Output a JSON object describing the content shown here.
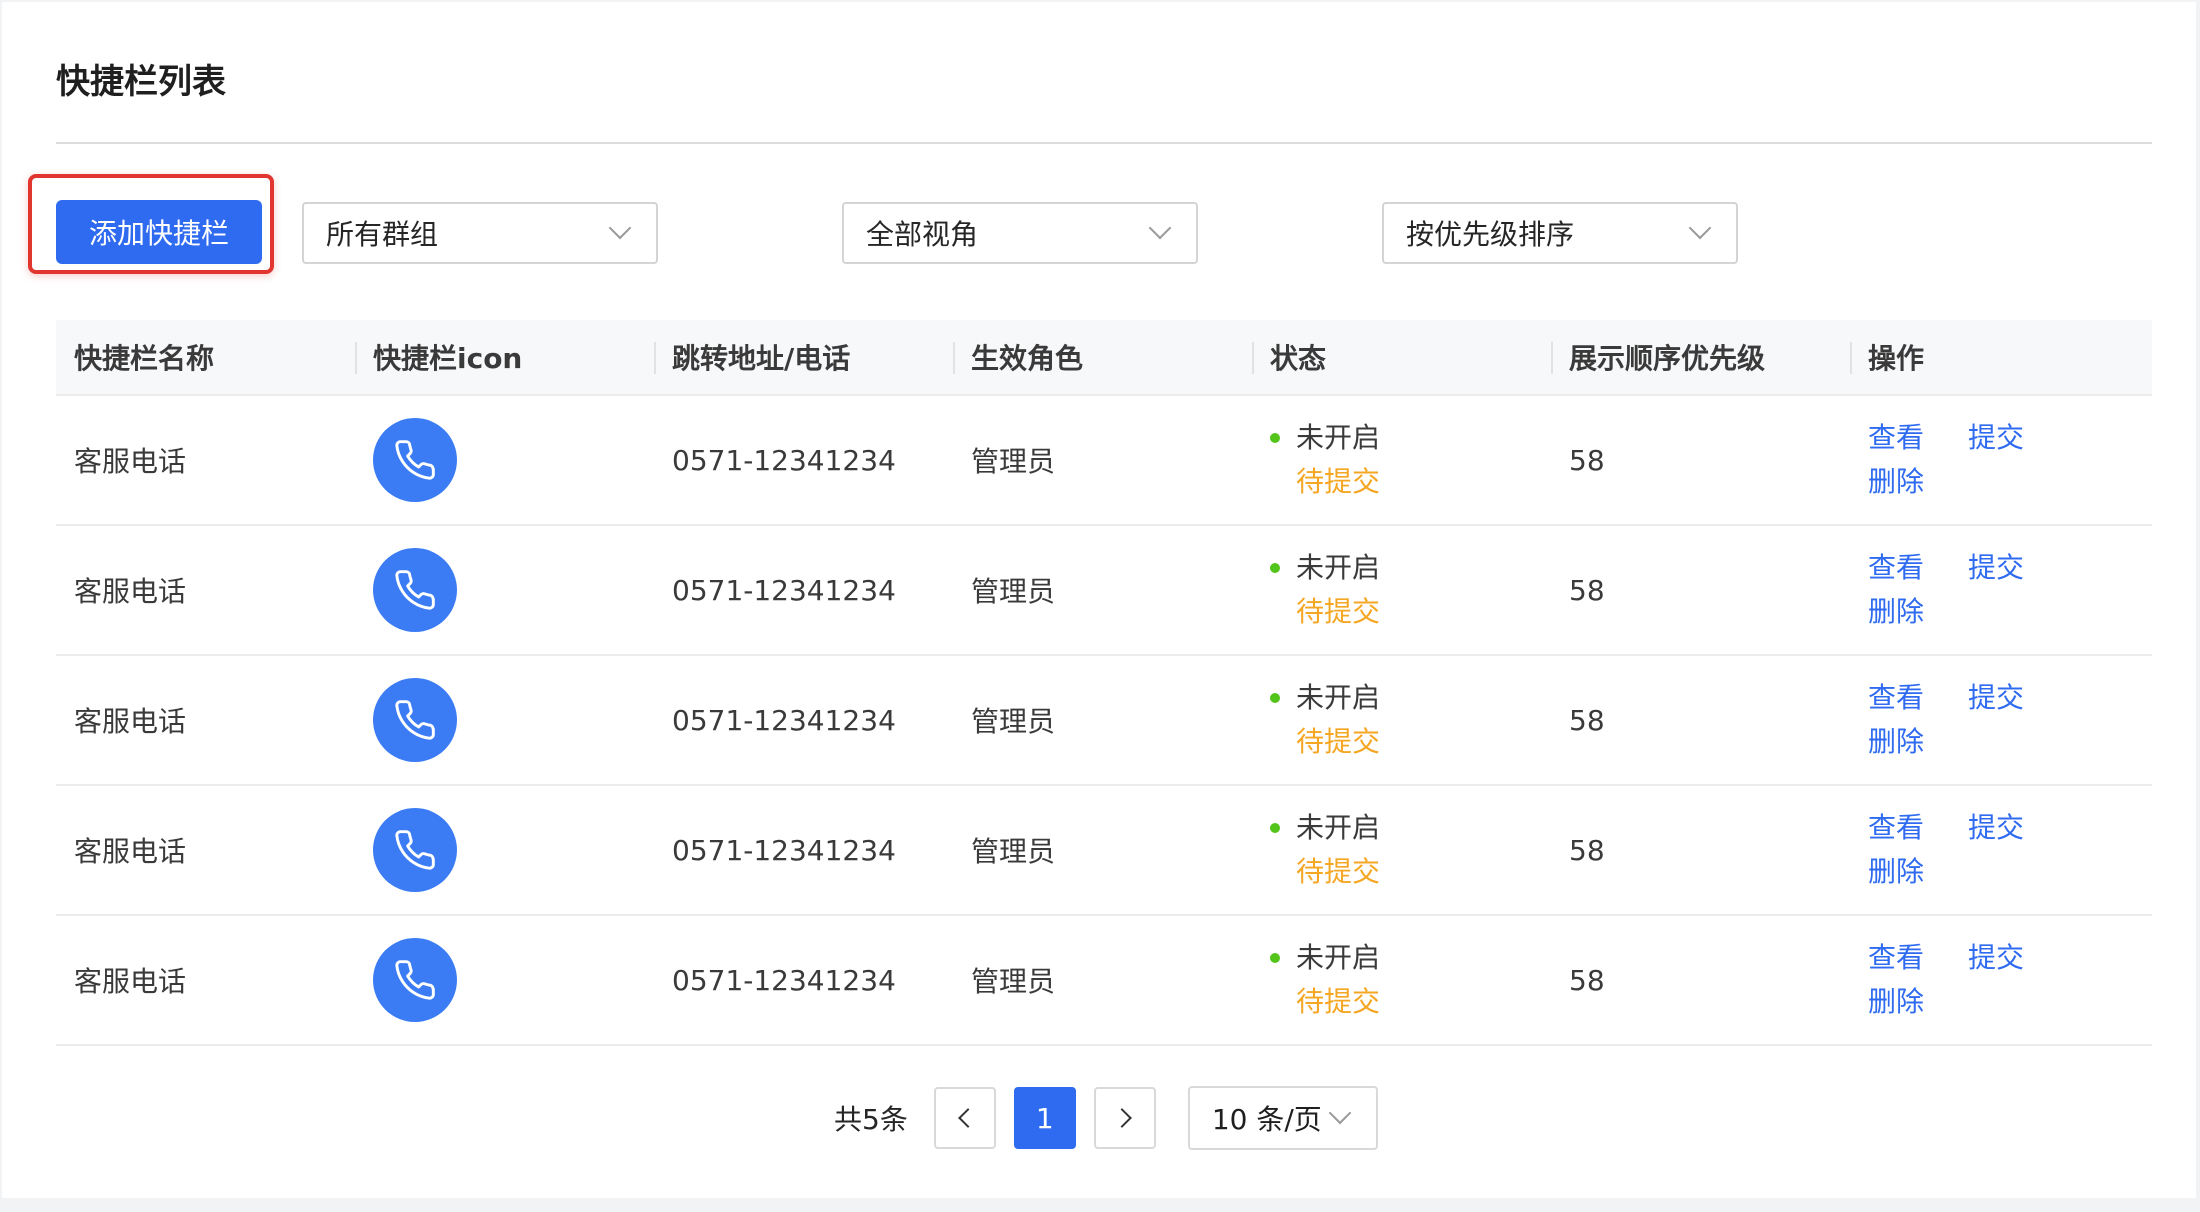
{
  "page": {
    "title": "快捷栏列表"
  },
  "toolbar": {
    "add_label": "添加快捷栏",
    "group_select": "所有群组",
    "view_select": "全部视角",
    "sort_select": "按优先级排序"
  },
  "table": {
    "columns": [
      "快捷栏名称",
      "快捷栏icon",
      "跳转地址/电话",
      "生效角色",
      "状态",
      "展示顺序优先级",
      "操作"
    ],
    "rows": [
      {
        "name": "客服电话",
        "icon": "phone-icon",
        "target": "0571-12341234",
        "role": "管理员",
        "status": "未开启",
        "sub_status": "待提交",
        "priority": "58",
        "actions": [
          "查看",
          "提交",
          "删除"
        ]
      },
      {
        "name": "客服电话",
        "icon": "phone-icon",
        "target": "0571-12341234",
        "role": "管理员",
        "status": "未开启",
        "sub_status": "待提交",
        "priority": "58",
        "actions": [
          "查看",
          "提交",
          "删除"
        ]
      },
      {
        "name": "客服电话",
        "icon": "phone-icon",
        "target": "0571-12341234",
        "role": "管理员",
        "status": "未开启",
        "sub_status": "待提交",
        "priority": "58",
        "actions": [
          "查看",
          "提交",
          "删除"
        ]
      },
      {
        "name": "客服电话",
        "icon": "phone-icon",
        "target": "0571-12341234",
        "role": "管理员",
        "status": "未开启",
        "sub_status": "待提交",
        "priority": "58",
        "actions": [
          "查看",
          "提交",
          "删除"
        ]
      },
      {
        "name": "客服电话",
        "icon": "phone-icon",
        "target": "0571-12341234",
        "role": "管理员",
        "status": "未开启",
        "sub_status": "待提交",
        "priority": "58",
        "actions": [
          "查看",
          "提交",
          "删除"
        ]
      }
    ]
  },
  "pagination": {
    "total_text": "共5条",
    "current_page": "1",
    "page_size": "10 条/页"
  },
  "colors": {
    "primary": "#2f6bf0",
    "highlight": "#e0362f",
    "status_dot": "#52c41a",
    "pending": "#f5a623"
  }
}
